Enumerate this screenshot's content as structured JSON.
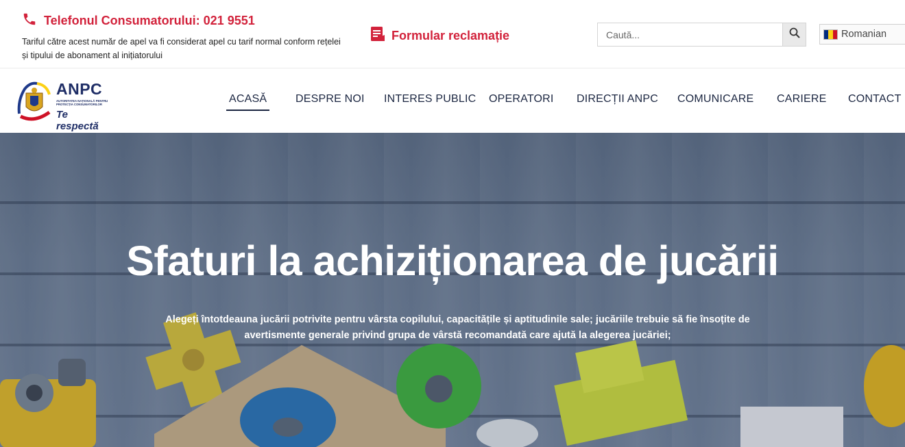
{
  "topbar": {
    "phone_title": "Telefonul Consumatorului: 021 9551",
    "phone_note": "Tariful către acest număr de apel va fi considerat apel cu tarif normal conform rețelei și tipului de abonament al inițiatorului",
    "complaint_label": "Formular reclamație",
    "search_placeholder": "Caută...",
    "language_label": "Romanian",
    "accent_color": "#d2223b"
  },
  "logo": {
    "brand": "ANPC",
    "subtitle": "Autoritatea Națională pentru Protecția Consumatorilor",
    "slogan": "Te respectă"
  },
  "nav": {
    "items": [
      {
        "label": "ACASĂ",
        "active": true
      },
      {
        "label": "DESPRE NOI"
      },
      {
        "label": "INTERES PUBLIC"
      },
      {
        "label": "OPERATORI"
      },
      {
        "label": "DIRECȚII ANPC"
      },
      {
        "label": "COMUNICARE"
      },
      {
        "label": "CARIERE"
      },
      {
        "label": "CONTACT"
      }
    ]
  },
  "hero": {
    "title": "Sfaturi la achiziționarea de jucării",
    "text": "Alegeți întotdeauna jucării potrivite pentru vârsta copilului, capacitățile și aptitudinile sale; jucăriile trebuie să fie  însoțite de avertismente generale privind grupa de vârstă recomandată care ajută la alegerea jucăriei;"
  },
  "icons": {
    "phone": "phone-icon",
    "complaint": "document-icon",
    "search": "search-icon",
    "flag": "romania-flag-icon"
  },
  "colors": {
    "navy": "#1a2540",
    "flag_blue": "#002b7f",
    "flag_yellow": "#fcd116",
    "flag_red": "#ce1126"
  }
}
